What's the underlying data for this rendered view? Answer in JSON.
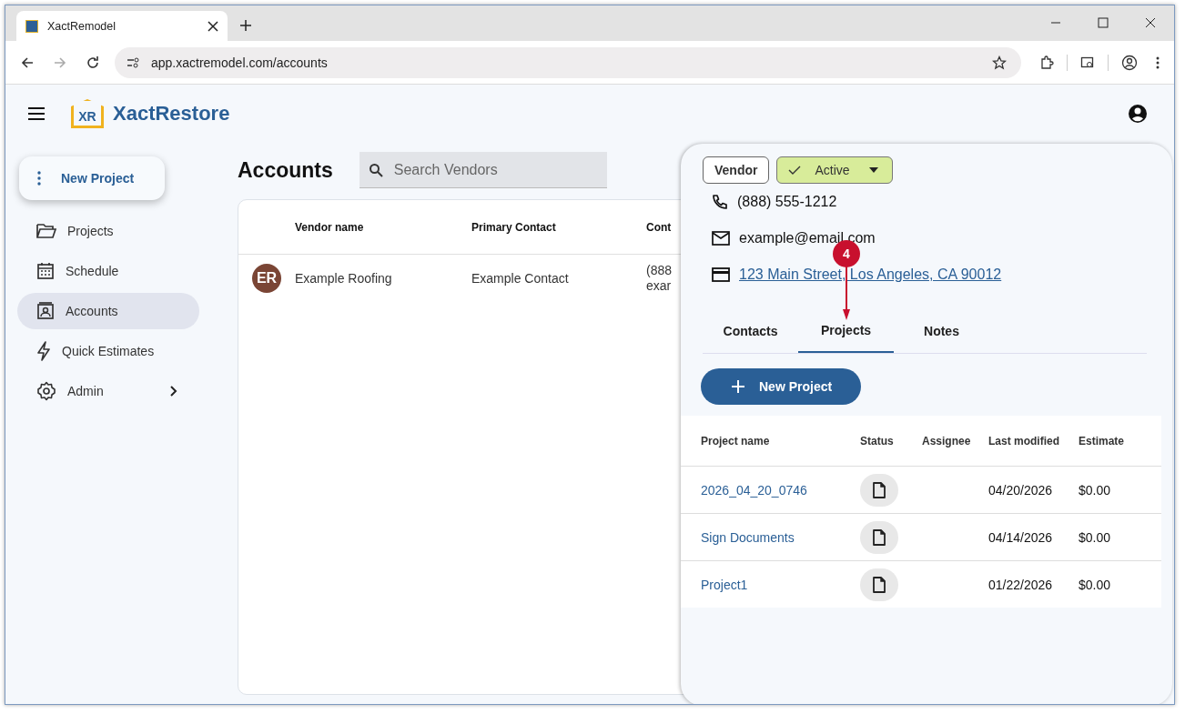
{
  "browser": {
    "tab_title": "XactRemodel",
    "url": "app.xactremodel.com/accounts"
  },
  "header": {
    "logo_mark": "XR",
    "brand": "XactRestore"
  },
  "sidebar": {
    "new_project": "New Project",
    "items": [
      {
        "label": "Projects",
        "kind": "folder",
        "selected": false,
        "submenu": false
      },
      {
        "label": "Schedule",
        "kind": "calendar",
        "selected": false,
        "submenu": false
      },
      {
        "label": "Accounts",
        "kind": "contact",
        "selected": true,
        "submenu": false
      },
      {
        "label": "Quick Estimates",
        "kind": "bolt",
        "selected": false,
        "submenu": false
      },
      {
        "label": "Admin",
        "kind": "gear",
        "selected": false,
        "submenu": true
      }
    ]
  },
  "accounts": {
    "title": "Accounts",
    "search": {
      "placeholder": "Search Vendors"
    },
    "columns": [
      "Vendor name",
      "Primary Contact",
      "Cont"
    ],
    "rows": [
      {
        "initials": "ER",
        "color": "#7a4535",
        "vendor": "Example Roofing",
        "contact": "Example Contact",
        "column_3": [
          "(888",
          "exar"
        ]
      }
    ]
  },
  "panel": {
    "type_chip": "Vendor",
    "status": {
      "label": "Active",
      "checked": true
    },
    "details": [
      {
        "kind": "phone",
        "text": "(888) 555-1212"
      },
      {
        "kind": "email",
        "text": "example@email.com"
      },
      {
        "kind": "address",
        "text": "123 Main Street, Los Angeles, CA 90012"
      }
    ],
    "tabs": [
      {
        "label": "Contacts",
        "selected": false
      },
      {
        "label": "Projects",
        "selected": true
      },
      {
        "label": "Notes",
        "selected": false
      }
    ],
    "new_project": "New Project",
    "columns": [
      "Project name",
      "Status",
      "Assignee",
      "Last modified",
      "Estimate"
    ],
    "rows": [
      {
        "name": "2026_04_20_0746",
        "modified": "04/20/2026",
        "estimate": "$0.00"
      },
      {
        "name": "Sign Documents",
        "modified": "04/14/2026",
        "estimate": "$0.00"
      },
      {
        "name": "Project1",
        "modified": "01/22/2026",
        "estimate": "$0.00"
      }
    ]
  },
  "callout": {
    "number": "4"
  }
}
